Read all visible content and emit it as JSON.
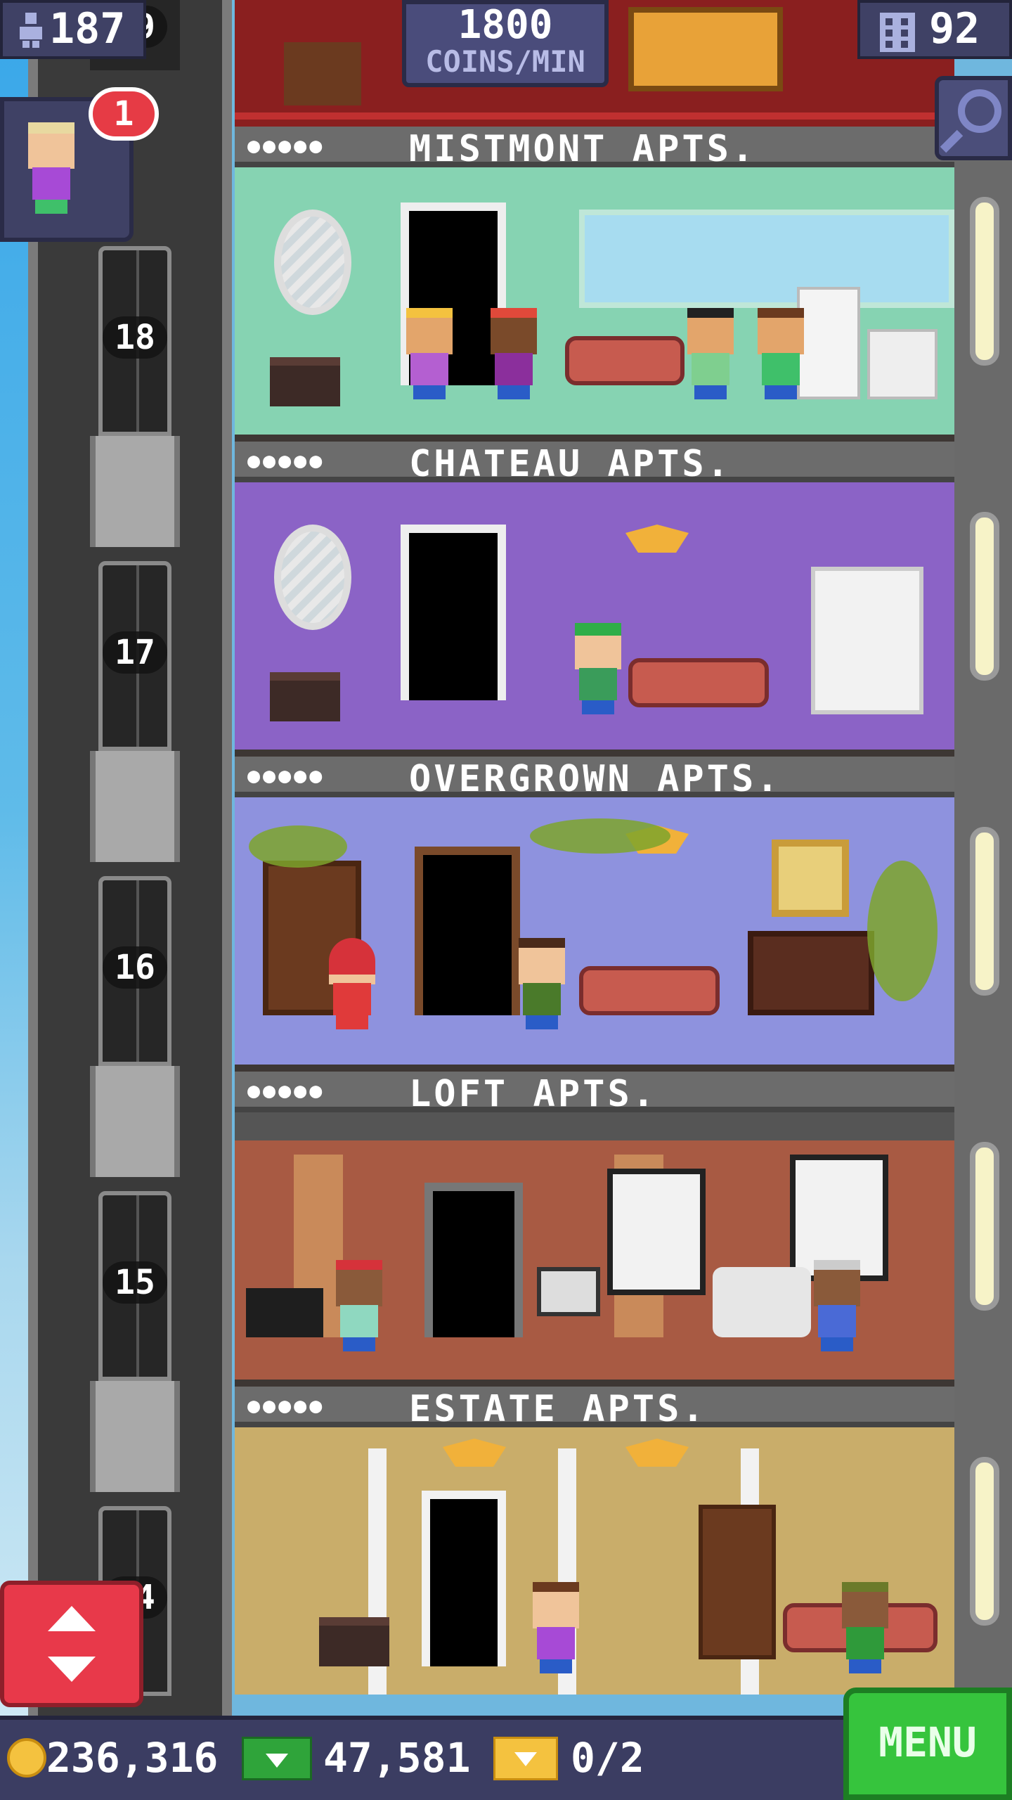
{
  "hud": {
    "population": "187",
    "coins_per_min_value": "1800",
    "coins_per_min_unit": "COINS/MIN",
    "floor_count": "92",
    "visitor_badge": "1"
  },
  "elevator": {
    "floors": [
      "18",
      "17",
      "16",
      "15",
      "14"
    ],
    "top_partial_label": "19"
  },
  "floors": [
    {
      "name": "MISTMONT APTS.",
      "pips": "●●●●●",
      "wall": "#86d3b2"
    },
    {
      "name": "CHATEAU APTS.",
      "pips": "●●●●●",
      "wall": "#8b63c6"
    },
    {
      "name": "OVERGROWN APTS.",
      "pips": "●●●●●",
      "wall": "#8e92de"
    },
    {
      "name": "LOFT APTS.",
      "pips": "●●●●●",
      "wall": "#a85a43"
    },
    {
      "name": "ESTATE APTS.",
      "pips": "●●●●●",
      "wall": "#c9ad6a"
    }
  ],
  "bottom_bar": {
    "coins": "236,316",
    "bux": "47,581",
    "tickets": "0/2",
    "menu_label": "MENU"
  },
  "colors": {
    "menu_green": "#36c43d",
    "elevator_red": "#e8394a",
    "hud_navy": "#3f4165",
    "badge_red": "#e63b45"
  },
  "icons": [
    "person-icon",
    "building-icon",
    "magnifier-icon",
    "up-down-arrows-icon",
    "coin-icon",
    "bux-icon",
    "ticket-icon"
  ]
}
